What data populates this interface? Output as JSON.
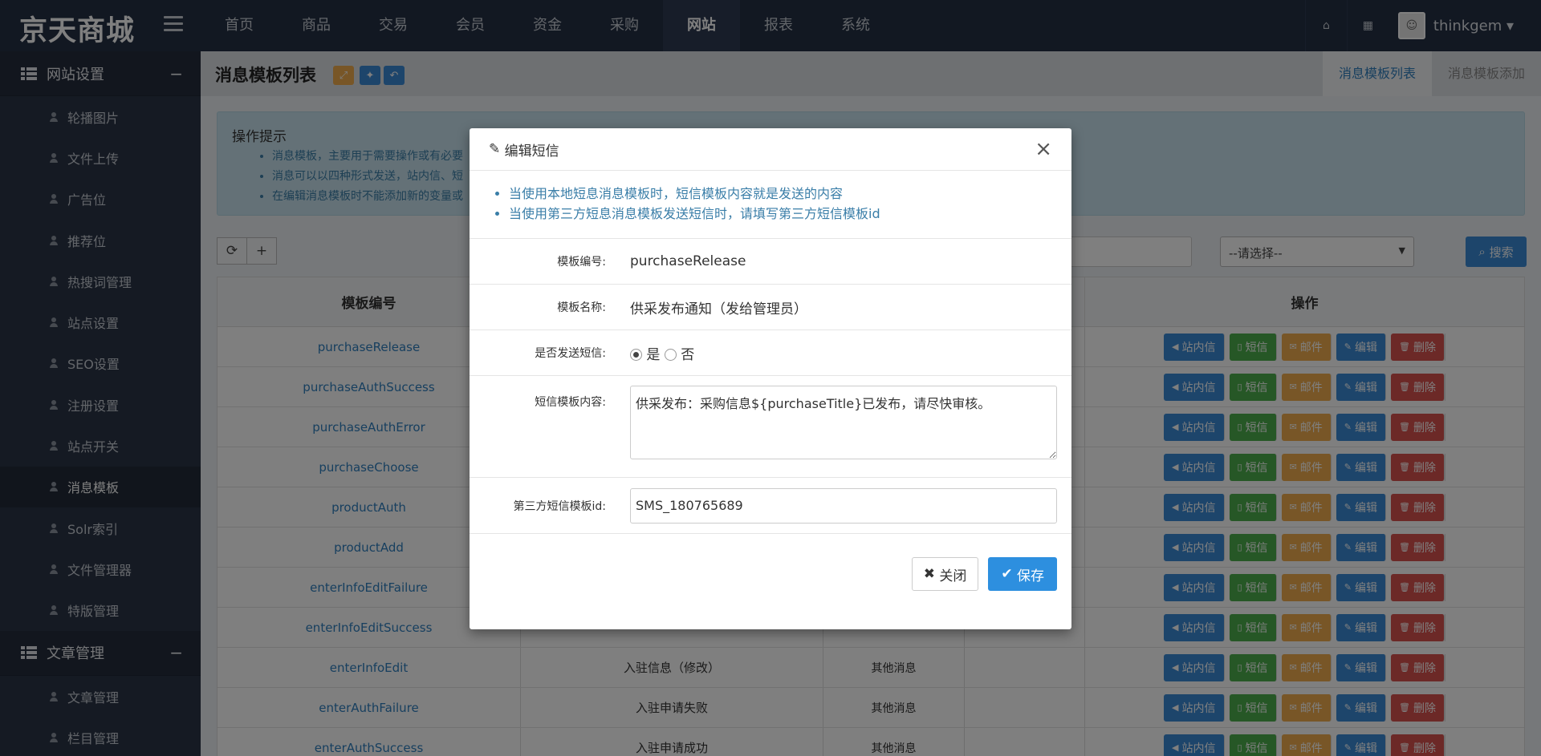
{
  "app": {
    "brand": "京天商城",
    "nav": [
      "首页",
      "商品",
      "交易",
      "会员",
      "资金",
      "采购",
      "网站",
      "报表",
      "系统"
    ],
    "active_nav": "网站",
    "user": "thinkgem ▾"
  },
  "sidebar": {
    "group1": "网站设置",
    "items": [
      "轮播图片",
      "文件上传",
      "广告位",
      "推荐位",
      "热搜词管理",
      "站点设置",
      "SEO设置",
      "注册设置",
      "站点开关",
      "消息模板",
      "Solr索引",
      "文件管理器",
      "特版管理"
    ],
    "active_item": "消息模板",
    "group2": "文章管理",
    "items2": [
      "文章管理",
      "栏目管理"
    ]
  },
  "page": {
    "title": "消息模板列表",
    "tab_list": "消息模板列表",
    "tab_add": "消息模板添加",
    "tips_title": "操作提示",
    "tips": [
      "消息模板，主要用于需要操作或有必要",
      "消息可以以四种形式发送，站内信、短",
      "在编辑消息模板时不能添加新的变量或"
    ]
  },
  "filters": {
    "select_value": "--请选择--",
    "search_label": "搜索"
  },
  "table": {
    "headers": [
      "模板编号",
      "",
      "",
      "",
      "操作"
    ],
    "ops": [
      "站内信",
      "短信",
      "邮件",
      "编辑",
      "删除"
    ],
    "rows": [
      {
        "code": "purchaseRelease",
        "name": "",
        "type": ""
      },
      {
        "code": "purchaseAuthSuccess",
        "name": "",
        "type": ""
      },
      {
        "code": "purchaseAuthError",
        "name": "",
        "type": ""
      },
      {
        "code": "purchaseChoose",
        "name": "",
        "type": ""
      },
      {
        "code": "productAuth",
        "name": "",
        "type": ""
      },
      {
        "code": "productAdd",
        "name": "",
        "type": ""
      },
      {
        "code": "enterInfoEditFailure",
        "name": "",
        "type": ""
      },
      {
        "code": "enterInfoEditSuccess",
        "name": "",
        "type": ""
      },
      {
        "code": "enterInfoEdit",
        "name": "入驻信息（修改）",
        "type": "其他消息"
      },
      {
        "code": "enterAuthFailure",
        "name": "入驻申请失败",
        "type": "其他消息"
      },
      {
        "code": "enterAuthSuccess",
        "name": "入驻申请成功",
        "type": "其他消息"
      }
    ]
  },
  "modal": {
    "title": "编辑短信",
    "notes": [
      "当使用本地短息消息模板时，短信模板内容就是发送的内容",
      "当使用第三方短息消息模板发送短信时，请填写第三方短信模板id"
    ],
    "label_code": "模板编号:",
    "value_code": "purchaseRelease",
    "label_name": "模板名称:",
    "value_name": "供采发布通知（发给管理员）",
    "label_send": "是否发送短信:",
    "opt_yes": "是",
    "opt_no": "否",
    "label_content": "短信模板内容:",
    "value_content": "供采发布：采购信息${purchaseTitle}已发布，请尽快审核。",
    "label_third": "第三方短信模板id:",
    "value_third": "SMS_180765689",
    "btn_close": "关闭",
    "btn_save": "保存"
  }
}
